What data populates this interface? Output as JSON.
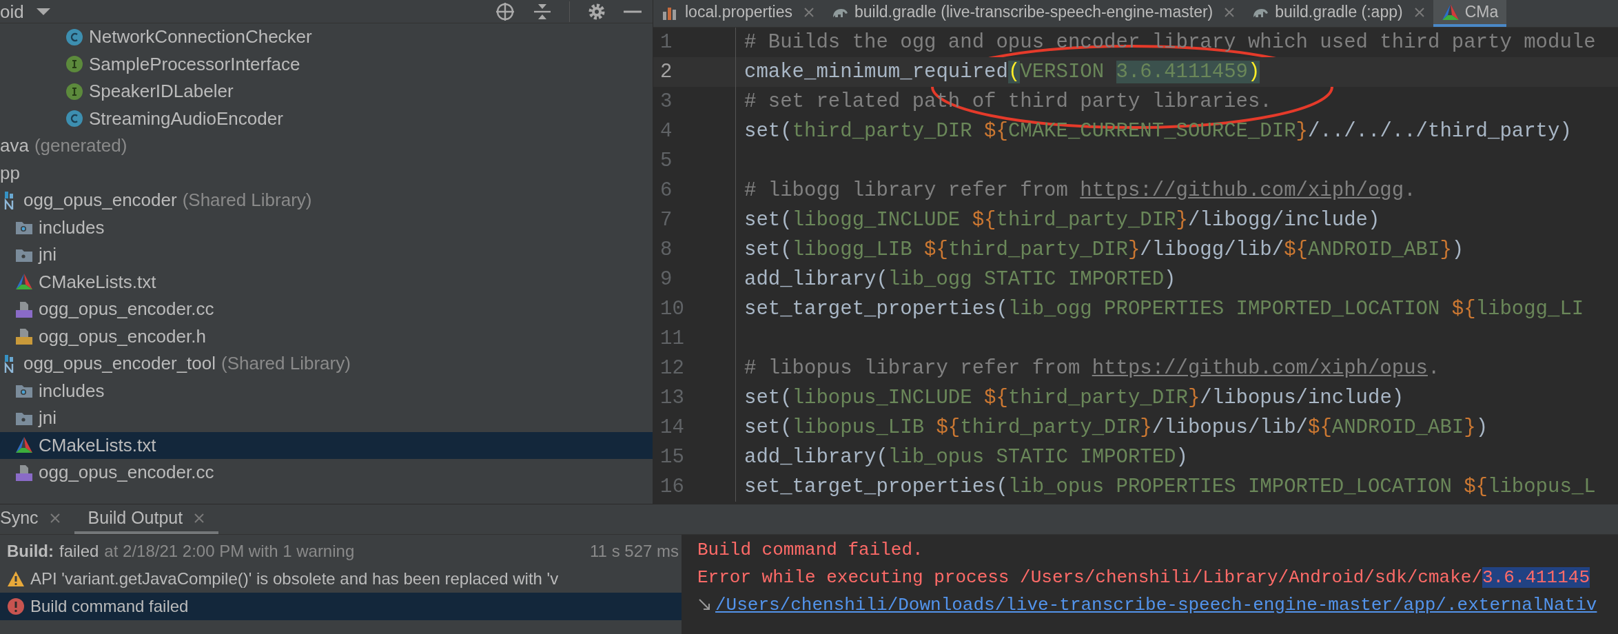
{
  "project_panel": {
    "title": "oid",
    "tree": [
      {
        "children": [
          {
            "label": "NetworkConnectionChecker",
            "kind": "class",
            "selected": false
          },
          {
            "label": "SampleProcessorInterface",
            "kind": "interface",
            "selected": false
          },
          {
            "label": "SpeakerIDLabeler",
            "kind": "interface",
            "selected": false
          },
          {
            "label": "StreamingAudioEncoder",
            "kind": "class",
            "selected": false
          }
        ]
      },
      {
        "label": "ava",
        "note": "(generated)",
        "selected": false
      },
      {
        "label": "pp",
        "selected": false
      },
      {
        "label": "ogg_opus_encoder",
        "note": "(Shared Library)",
        "kind": "native",
        "selected": false,
        "children": [
          {
            "label": "includes",
            "kind": "include-folder",
            "selected": false
          },
          {
            "label": "jni",
            "kind": "folder",
            "selected": false
          },
          {
            "label": "CMakeLists.txt",
            "kind": "cmake",
            "selected": false
          },
          {
            "label": "ogg_opus_encoder.cc",
            "kind": "cpp",
            "selected": false
          },
          {
            "label": "ogg_opus_encoder.h",
            "kind": "header",
            "selected": false
          }
        ]
      },
      {
        "label": "ogg_opus_encoder_tool",
        "note": "(Shared Library)",
        "kind": "native",
        "selected": false,
        "children": [
          {
            "label": "includes",
            "kind": "include-folder",
            "selected": false
          },
          {
            "label": "jni",
            "kind": "folder",
            "selected": false
          },
          {
            "label": "CMakeLists.txt",
            "kind": "cmake",
            "selected": true
          },
          {
            "label": "ogg_opus_encoder.cc",
            "kind": "cpp",
            "selected": false
          }
        ]
      }
    ]
  },
  "editor_tabs": [
    {
      "label": "local.properties",
      "kind": "properties",
      "selected": false,
      "closable": true
    },
    {
      "label": "build.gradle (live-transcribe-speech-engine-master)",
      "kind": "gradle",
      "selected": false,
      "closable": true
    },
    {
      "label": "build.gradle (:app)",
      "kind": "gradle",
      "selected": false,
      "closable": true
    },
    {
      "label": "CMa",
      "kind": "cmake",
      "selected": true,
      "closable": false
    }
  ],
  "code_lines": [
    {
      "number": "1",
      "current": false,
      "segments": [
        {
          "text": "# Builds the ogg and opus encoder library which used third party module",
          "kind": "comment"
        }
      ]
    },
    {
      "number": "2",
      "current": true,
      "segments": [
        {
          "text": "cmake_minimum_required",
          "kind": "plain"
        },
        {
          "text": "(",
          "kind": "paren"
        },
        {
          "text": "VERSION ",
          "kind": "arg"
        },
        {
          "text": "3.6.4111459",
          "kind": "match"
        },
        {
          "text": ")",
          "kind": "paren"
        }
      ]
    },
    {
      "number": "3",
      "current": false,
      "segments": [
        {
          "text": "# set related path of third party libraries.",
          "kind": "comment"
        }
      ]
    },
    {
      "number": "4",
      "current": false,
      "segments": [
        {
          "text": "set(",
          "kind": "plain"
        },
        {
          "text": "third_party_DIR ",
          "kind": "arg"
        },
        {
          "text": "${",
          "kind": "var"
        },
        {
          "text": "CMAKE_CURRENT_SOURCE_DIR",
          "kind": "arg"
        },
        {
          "text": "}",
          "kind": "var"
        },
        {
          "text": "/../../../third_party)",
          "kind": "plain"
        }
      ]
    },
    {
      "number": "5",
      "current": false
    },
    {
      "number": "6",
      "current": false,
      "segments": [
        {
          "text": "# libogg library refer from ",
          "kind": "comment"
        },
        {
          "text": "https://github.com/xiph/ogg",
          "kind": "link"
        },
        {
          "text": ".",
          "kind": "comment"
        }
      ]
    },
    {
      "number": "7",
      "current": false,
      "segments": [
        {
          "text": "set(",
          "kind": "plain"
        },
        {
          "text": "libogg_INCLUDE ",
          "kind": "arg"
        },
        {
          "text": "${",
          "kind": "var"
        },
        {
          "text": "third_party_DIR",
          "kind": "arg"
        },
        {
          "text": "}",
          "kind": "var"
        },
        {
          "text": "/libogg/include)",
          "kind": "plain"
        }
      ]
    },
    {
      "number": "8",
      "current": false,
      "segments": [
        {
          "text": "set(",
          "kind": "plain"
        },
        {
          "text": "libogg_LIB ",
          "kind": "arg"
        },
        {
          "text": "${",
          "kind": "var"
        },
        {
          "text": "third_party_DIR",
          "kind": "arg"
        },
        {
          "text": "}",
          "kind": "var"
        },
        {
          "text": "/libogg/lib/",
          "kind": "plain"
        },
        {
          "text": "${",
          "kind": "var"
        },
        {
          "text": "ANDROID_ABI",
          "kind": "arg"
        },
        {
          "text": "}",
          "kind": "var"
        },
        {
          "text": ")",
          "kind": "plain"
        }
      ]
    },
    {
      "number": "9",
      "current": false,
      "segments": [
        {
          "text": "add_library(",
          "kind": "plain"
        },
        {
          "text": "lib_ogg STATIC IMPORTED",
          "kind": "arg"
        },
        {
          "text": ")",
          "kind": "plain"
        }
      ]
    },
    {
      "number": "10",
      "current": false,
      "segments": [
        {
          "text": "set_target_properties(",
          "kind": "plain"
        },
        {
          "text": "lib_ogg PROPERTIES IMPORTED_LOCATION ",
          "kind": "arg"
        },
        {
          "text": "${",
          "kind": "var"
        },
        {
          "text": "libogg_LI",
          "kind": "arg"
        }
      ]
    },
    {
      "number": "11",
      "current": false
    },
    {
      "number": "12",
      "current": false,
      "segments": [
        {
          "text": "# libopus library refer from ",
          "kind": "comment"
        },
        {
          "text": "https://github.com/xiph/opus",
          "kind": "link"
        },
        {
          "text": ".",
          "kind": "comment"
        }
      ]
    },
    {
      "number": "13",
      "current": false,
      "segments": [
        {
          "text": "set(",
          "kind": "plain"
        },
        {
          "text": "libopus_INCLUDE ",
          "kind": "arg"
        },
        {
          "text": "${",
          "kind": "var"
        },
        {
          "text": "third_party_DIR",
          "kind": "arg"
        },
        {
          "text": "}",
          "kind": "var"
        },
        {
          "text": "/libopus/include)",
          "kind": "plain"
        }
      ]
    },
    {
      "number": "14",
      "current": false,
      "segments": [
        {
          "text": "set(",
          "kind": "plain"
        },
        {
          "text": "libopus_LIB ",
          "kind": "arg"
        },
        {
          "text": "${",
          "kind": "var"
        },
        {
          "text": "third_party_DIR",
          "kind": "arg"
        },
        {
          "text": "}",
          "kind": "var"
        },
        {
          "text": "/libopus/lib/",
          "kind": "plain"
        },
        {
          "text": "${",
          "kind": "var"
        },
        {
          "text": "ANDROID_ABI",
          "kind": "arg"
        },
        {
          "text": "}",
          "kind": "var"
        },
        {
          "text": ")",
          "kind": "plain"
        }
      ]
    },
    {
      "number": "15",
      "current": false,
      "segments": [
        {
          "text": "add_library(",
          "kind": "plain"
        },
        {
          "text": "lib_opus STATIC IMPORTED",
          "kind": "arg"
        },
        {
          "text": ")",
          "kind": "plain"
        }
      ]
    },
    {
      "number": "16",
      "current": false,
      "segments": [
        {
          "text": "set_target_properties(",
          "kind": "plain"
        },
        {
          "text": "lib_opus PROPERTIES IMPORTED_LOCATION ",
          "kind": "arg"
        },
        {
          "text": "${",
          "kind": "var"
        },
        {
          "text": "libopus_L",
          "kind": "arg"
        }
      ]
    }
  ],
  "bottom_tabs": [
    {
      "label": "Sync",
      "selected": false
    },
    {
      "label": "Build Output",
      "selected": true
    }
  ],
  "build_tree": [
    {
      "kind": "summary",
      "title": "Build:",
      "status": "failed",
      "detail": "at 2/18/21 2:00 PM with 1 warning",
      "time": "11 s 527 ms",
      "selected": false
    },
    {
      "kind": "warning",
      "text": "API 'variant.getJavaCompile()' is obsolete and has been replaced with 'v",
      "selected": false
    },
    {
      "kind": "error",
      "text": "Build command failed",
      "selected": true
    }
  ],
  "console": [
    {
      "kind": "text",
      "segments": [
        {
          "text": "Build command failed.",
          "kind": "error"
        }
      ]
    },
    {
      "kind": "text",
      "segments": [
        {
          "text": "Error while executing process /Users/chenshili/Library/Android/sdk/cmake/",
          "kind": "error"
        },
        {
          "text": "3.6.411145",
          "kind": "selection"
        }
      ]
    },
    {
      "kind": "link",
      "segments": [
        {
          "text": "/Users/chenshili/Downloads/live-transcribe-speech-engine-master/app/.externalNativ",
          "kind": "link"
        }
      ]
    }
  ]
}
